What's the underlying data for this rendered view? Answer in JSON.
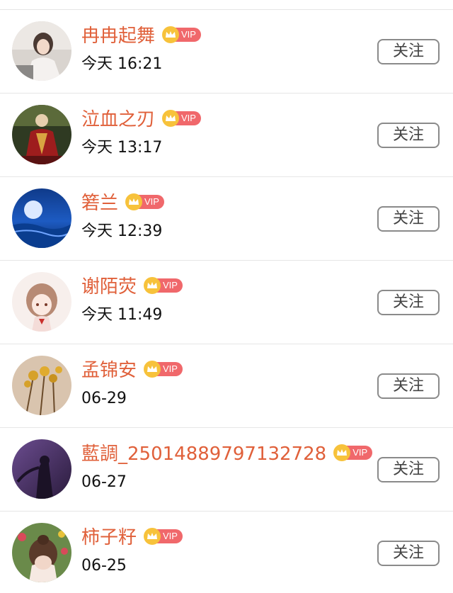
{
  "follow_label": "关注",
  "vip_label": "VIP",
  "users": [
    {
      "name": "冉冉起舞",
      "time": "今天 16:21"
    },
    {
      "name": "泣血之刃",
      "time": "今天 13:17"
    },
    {
      "name": "箬兰",
      "time": "今天 12:39"
    },
    {
      "name": "谢陌荧",
      "time": "今天 11:49"
    },
    {
      "name": "孟锦安",
      "time": "06-29"
    },
    {
      "name": "藍調_25014889797132728",
      "time": "06-27"
    },
    {
      "name": "柿子籽",
      "time": "06-25"
    }
  ],
  "colors": {
    "name": "#e0603a",
    "vip_tag": "#f0686b",
    "vip_crown": "#f7c23b",
    "divider": "#e6e6e6"
  }
}
